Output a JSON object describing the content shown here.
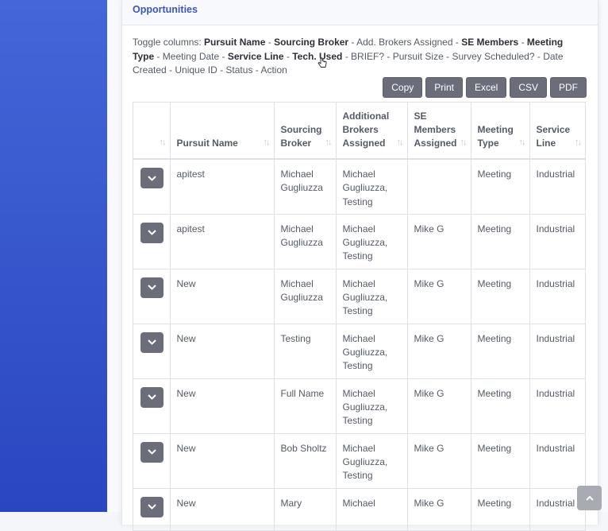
{
  "card": {
    "title": "Opportunities"
  },
  "toggle": {
    "prefix": "Toggle columns: ",
    "columns": [
      {
        "label": "Pursuit Name",
        "on": true
      },
      {
        "label": "Sourcing Broker",
        "on": true
      },
      {
        "label": "Add. Brokers Assigned",
        "on": false
      },
      {
        "label": "SE Members",
        "on": true
      },
      {
        "label": "Meeting Type",
        "on": true
      },
      {
        "label": "Meeting Date",
        "on": false
      },
      {
        "label": "Service Line",
        "on": true
      },
      {
        "label": "Tech. Used",
        "on": true
      },
      {
        "label": "BRIEF?",
        "on": false
      },
      {
        "label": "Pursuit Size",
        "on": false
      },
      {
        "label": "Survey Scheduled?",
        "on": false
      },
      {
        "label": "Date Created",
        "on": false
      },
      {
        "label": "Unique ID",
        "on": false
      },
      {
        "label": "Status",
        "on": false
      },
      {
        "label": "Action",
        "on": false
      }
    ],
    "separator": " - "
  },
  "buttons": {
    "copy": "Copy",
    "print": "Print",
    "excel": "Excel",
    "csv": "CSV",
    "pdf": "PDF"
  },
  "table": {
    "headers": [
      "",
      "Pursuit Name",
      "Sourcing Broker",
      "Additional Brokers Assigned",
      "SE Members Assigned",
      "Meeting Type",
      "Service Line"
    ],
    "rows": [
      [
        "apitest",
        "Michael Gugliuzza",
        "Michael Gugliuzza, Testing",
        "",
        "Meeting",
        "Industrial"
      ],
      [
        "apitest",
        "Michael Gugliuzza",
        "Michael Gugliuzza, Testing",
        "Mike G",
        "Meeting",
        "Industrial"
      ],
      [
        "New",
        "Michael Gugliuzza",
        "Michael Gugliuzza, Testing",
        "Mike G",
        "Meeting",
        "Industrial"
      ],
      [
        "New",
        "Testing",
        "Michael Gugliuzza, Testing",
        "Mike G",
        "Meeting",
        "Industrial"
      ],
      [
        "New",
        "Full Name",
        "Michael Gugliuzza, Testing",
        "Mike G",
        "Meeting",
        "Industrial"
      ],
      [
        "New",
        "Bob Sholtz",
        "Michael Gugliuzza, Testing",
        "Mike G",
        "Meeting",
        "Industrial"
      ],
      [
        "New",
        "Mary",
        "Michael",
        "Mike G",
        "Meeting",
        "Industrial"
      ]
    ]
  },
  "icons": {
    "expand": "chevron-down-icon",
    "sort": "sort-arrows-icon",
    "scroll_top": "chevron-up-icon"
  },
  "colors": {
    "sidebar": "#3655cc",
    "title": "#3c56b8",
    "button": "#6b6e7a"
  }
}
